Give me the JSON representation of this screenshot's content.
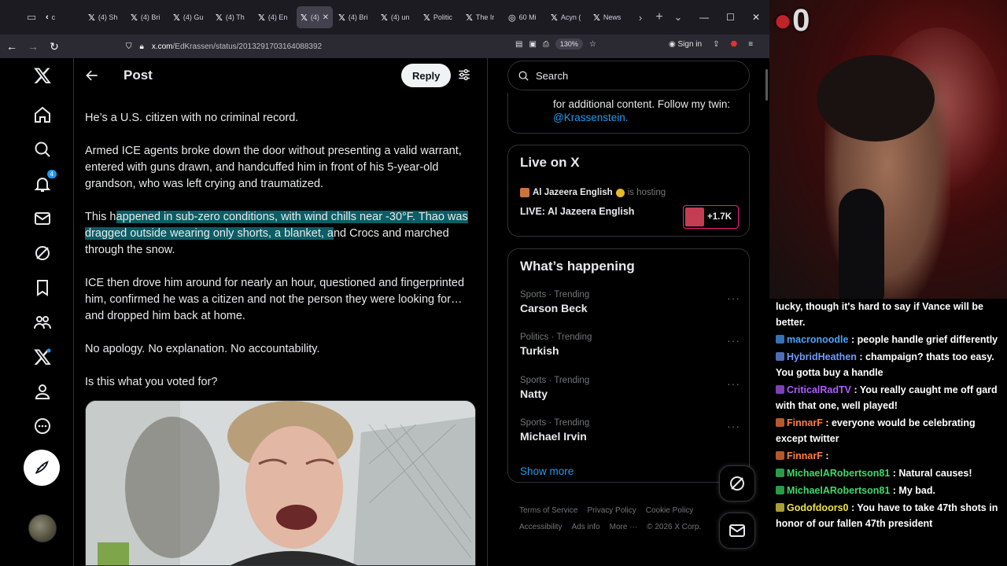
{
  "browser": {
    "tabs": [
      {
        "icon": "‹",
        "label": "c"
      },
      {
        "icon": "𝕏",
        "label": "(4) Sh"
      },
      {
        "icon": "𝕏",
        "label": "(4) Bri"
      },
      {
        "icon": "𝕏",
        "label": "(4) Gu"
      },
      {
        "icon": "𝕏",
        "label": "(4) Th"
      },
      {
        "icon": "𝕏",
        "label": "(4) En"
      },
      {
        "icon": "𝕏",
        "label": "(4)",
        "active": true
      },
      {
        "icon": "𝕏",
        "label": "(4) Bri"
      },
      {
        "icon": "𝕏",
        "label": "(4) un"
      },
      {
        "icon": "𝕏",
        "label": "Politic"
      },
      {
        "icon": "𝕏",
        "label": "The Ir"
      },
      {
        "icon": "◎",
        "label": "60 Mi"
      },
      {
        "icon": "𝕏",
        "label": "Acyn ("
      },
      {
        "icon": "𝕏",
        "label": "News"
      }
    ],
    "url_domain": "x.com",
    "url_path": "/EdKrassen/status/2013291703164088392",
    "zoom": "130%",
    "sign_in": "Sign in"
  },
  "x": {
    "header": {
      "title": "Post",
      "reply_label": "Reply"
    },
    "post_paragraphs": {
      "p1": "He’s a U.S. citizen with no criminal record.",
      "p2": "Armed ICE agents broke down the door without presenting a valid warrant, entered with guns drawn, and handcuffed him in front of his 5-year-old grandson, who was left crying and traumatized.",
      "p3a": "This h",
      "p3b": "appened in sub-zero conditions, with wind chills near -30°F. Thao was dragged outside wearing only shorts, a blanket, a",
      "p3c": "nd Crocs and marched through the snow.",
      "p4": "ICE then drove him around for nearly an hour, questioned and fingerprinted him, confirmed he was a citizen and not the person they were looking for… and dropped him back at home.",
      "p5": "No apology. No explanation. No accountability.",
      "p6": "Is this what you voted for?"
    },
    "search_placeholder": "Search",
    "bio": {
      "text": "for additional content. Follow my twin:",
      "mention": "@Krassenstein."
    },
    "live": {
      "title": "Live on X",
      "host": "Al Jazeera English",
      "hosting_text": "is hosting",
      "stream_name": "LIVE: Al Jazeera English",
      "listeners": "+1.7K"
    },
    "happening": {
      "title": "What’s happening",
      "trends": [
        {
          "meta": "Sports · Trending",
          "name": "Carson Beck"
        },
        {
          "meta": "Politics · Trending",
          "name": "Turkish"
        },
        {
          "meta": "Sports · Trending",
          "name": "Natty"
        },
        {
          "meta": "Sports · Trending",
          "name": "Michael Irvin"
        }
      ],
      "show_more": "Show more"
    },
    "footer": {
      "terms": "Terms of Service",
      "privacy": "Privacy Policy",
      "cookie": "Cookie Policy",
      "access": "Accessibility",
      "ads": "Ads info",
      "more": "More ···",
      "copyright": "© 2026 X Corp."
    },
    "notification_count": "4"
  },
  "stream": {
    "overlay_number": "0",
    "chat": [
      {
        "user": "",
        "message": "lucky, though it's hard to say if Vance will be better.",
        "color": "#ffffff"
      },
      {
        "user": "macronoodle",
        "message": ": people handle grief differently",
        "color": "#4aa3ff"
      },
      {
        "user": "HybridHeathen",
        "message": ": champaign? thats too easy. You gotta buy a handle",
        "color": "#6f9bff"
      },
      {
        "user": "CriticalRadTV",
        "message": ": You really caught me off gard with that one, well played!",
        "color": "#b05cff"
      },
      {
        "user": "FinnarF",
        "message": ": everyone would be celebrating except twitter",
        "color": "#ff7f3f"
      },
      {
        "user": "FinnarF",
        "message": ":",
        "color": "#ff7f3f"
      },
      {
        "user": "MichaelARobertson81",
        "message": ": Natural causes!",
        "color": "#3fd96a"
      },
      {
        "user": "MichaelARobertson81",
        "message": ": My bad.",
        "color": "#3fd96a"
      },
      {
        "user": "Godofdoors0",
        "message": ": You have to take 47th shots in honor of our fallen 47th president",
        "color": "#f0e14a"
      }
    ]
  }
}
